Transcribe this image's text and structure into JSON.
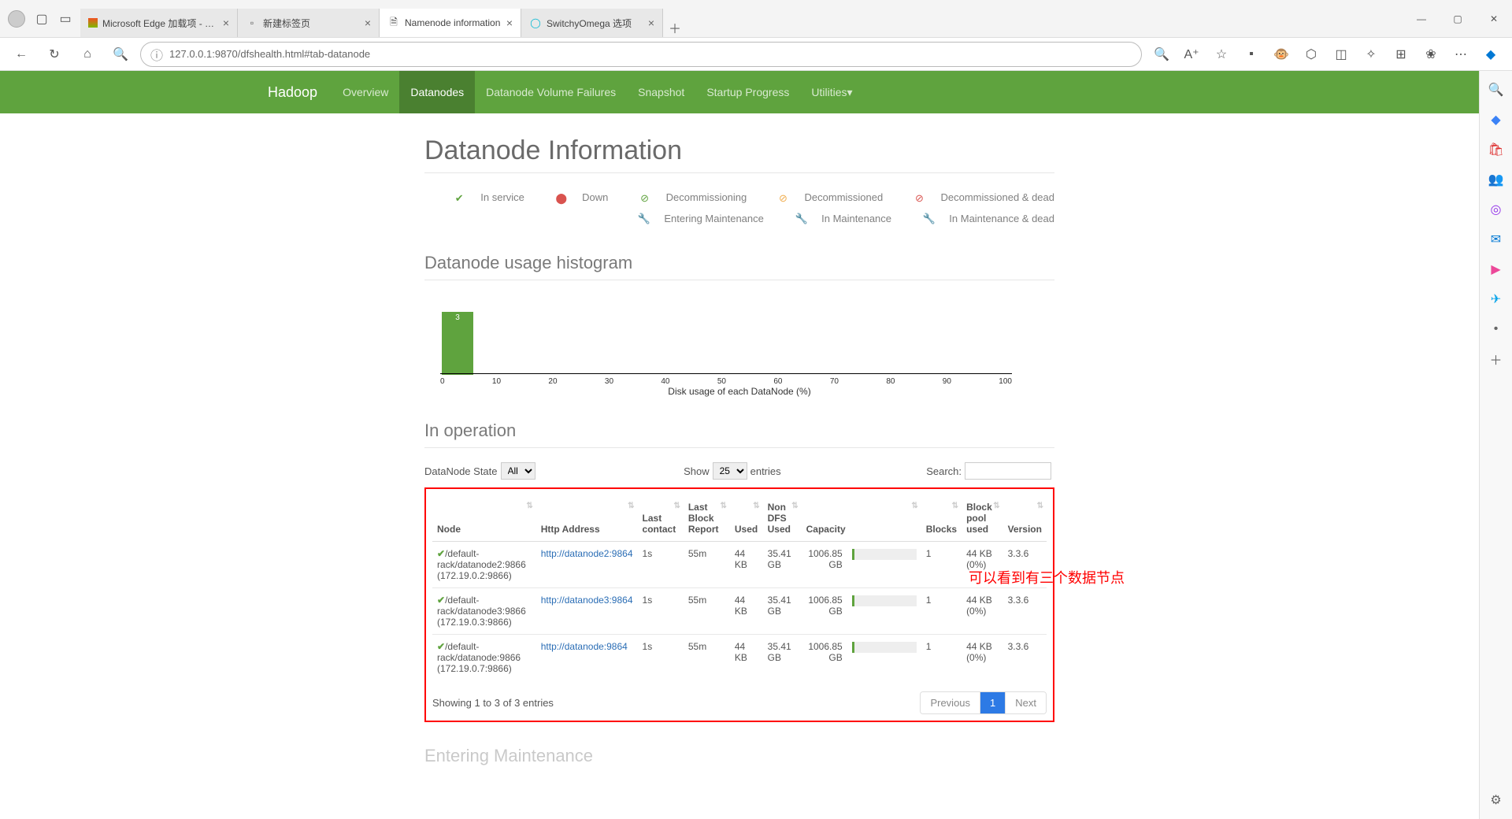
{
  "browser": {
    "tabs": [
      {
        "title": "Microsoft Edge 加载项 - Switchy",
        "favicon": "ms"
      },
      {
        "title": "新建标签页",
        "favicon": "blank"
      },
      {
        "title": "Namenode information",
        "favicon": "doc",
        "active": true
      },
      {
        "title": "SwitchyOmega 选项",
        "favicon": "so"
      }
    ],
    "url": "127.0.0.1:9870/dfshealth.html#tab-datanode"
  },
  "nav": {
    "brand": "Hadoop",
    "items": [
      "Overview",
      "Datanodes",
      "Datanode Volume Failures",
      "Snapshot",
      "Startup Progress",
      "Utilities"
    ],
    "active": "Datanodes"
  },
  "page": {
    "title": "Datanode Information",
    "legend": [
      "In service",
      "Down",
      "Decommissioning",
      "Decommissioned",
      "Decommissioned & dead",
      "Entering Maintenance",
      "In Maintenance",
      "In Maintenance & dead"
    ],
    "hist_title": "Datanode usage histogram",
    "hist_bar_value": "3",
    "hist_xlabel": "Disk usage of each DataNode (%)",
    "inop_title": "In operation",
    "state_label": "DataNode State",
    "state_value": "All",
    "show_label": "Show",
    "show_value": "25",
    "entries_label": "entries",
    "search_label": "Search:",
    "columns": [
      "Node",
      "Http Address",
      "Last contact",
      "Last Block Report",
      "Used",
      "Non DFS Used",
      "Capacity",
      "Blocks",
      "Block pool used",
      "Version"
    ],
    "rows": [
      {
        "node": "/default-rack/datanode2:9866",
        "ip": "(172.19.0.2:9866)",
        "http": "http://datanode2:9864",
        "lc": "1s",
        "lbr": "55m",
        "used": "44 KB",
        "nondfs": "35.41 GB",
        "cap": "1006.85 GB",
        "blocks": "1",
        "bp": "44 KB (0%)",
        "ver": "3.3.6"
      },
      {
        "node": "/default-rack/datanode3:9866",
        "ip": "(172.19.0.3:9866)",
        "http": "http://datanode3:9864",
        "lc": "1s",
        "lbr": "55m",
        "used": "44 KB",
        "nondfs": "35.41 GB",
        "cap": "1006.85 GB",
        "blocks": "1",
        "bp": "44 KB (0%)",
        "ver": "3.3.6"
      },
      {
        "node": "/default-rack/datanode:9866",
        "ip": "(172.19.0.7:9866)",
        "http": "http://datanode:9864",
        "lc": "1s",
        "lbr": "55m",
        "used": "44 KB",
        "nondfs": "35.41 GB",
        "cap": "1006.85 GB",
        "blocks": "1",
        "bp": "44 KB (0%)",
        "ver": "3.3.6"
      }
    ],
    "showing": "Showing 1 to 3 of 3 entries",
    "prev": "Previous",
    "page1": "1",
    "next": "Next",
    "next_section": "Entering Maintenance"
  },
  "annotation": "可以看到有三个数据节点",
  "chart_data": {
    "type": "bar",
    "title": "Datanode usage histogram",
    "xlabel": "Disk usage of each DataNode (%)",
    "ylabel": "",
    "categories": [
      0,
      10,
      20,
      30,
      40,
      50,
      60,
      70,
      80,
      90,
      100
    ],
    "values": [
      3,
      0,
      0,
      0,
      0,
      0,
      0,
      0,
      0,
      0,
      0
    ],
    "xlim": [
      0,
      100
    ]
  }
}
